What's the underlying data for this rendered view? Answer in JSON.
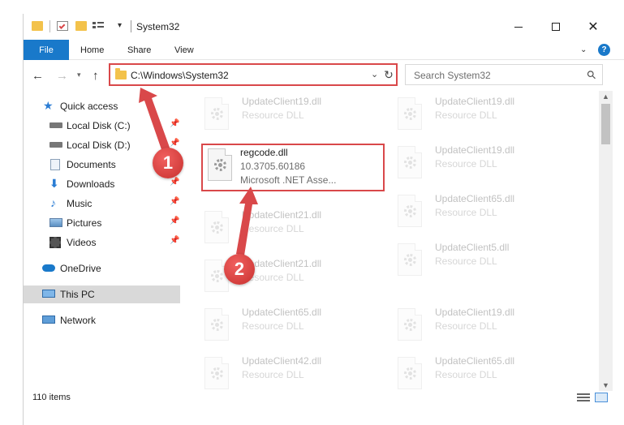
{
  "window": {
    "title": "System32"
  },
  "ribbon": {
    "file": "File",
    "home": "Home",
    "share": "Share",
    "view": "View"
  },
  "nav": {
    "address": "C:\\Windows\\System32",
    "search_placeholder": "Search System32"
  },
  "sidebar": {
    "items": [
      {
        "label": "Quick access",
        "icon": "star-icon"
      },
      {
        "label": "Local Disk (C:)",
        "icon": "drive-icon"
      },
      {
        "label": "Local Disk (D:)",
        "icon": "drive-icon"
      },
      {
        "label": "Documents",
        "icon": "documents-icon"
      },
      {
        "label": "Downloads",
        "icon": "download-icon"
      },
      {
        "label": "Music",
        "icon": "music-icon"
      },
      {
        "label": "Pictures",
        "icon": "pictures-icon"
      },
      {
        "label": "Videos",
        "icon": "videos-icon"
      },
      {
        "label": "OneDrive",
        "icon": "cloud-icon"
      },
      {
        "label": "This PC",
        "icon": "computer-icon"
      },
      {
        "label": "Network",
        "icon": "network-icon"
      }
    ]
  },
  "files": {
    "highlighted": {
      "name": "regcode.dll",
      "version": "10.3705.60186",
      "desc": "Microsoft .NET Asse..."
    },
    "left": [
      {
        "name": "UpdateClient19.dll",
        "desc": "Resource DLL"
      },
      {
        "name": "UpdateClient21.dll",
        "desc": "Resource DLL"
      },
      {
        "name": "UpdateClient21.dll",
        "desc": "Resource DLL"
      },
      {
        "name": "UpdateClient65.dll",
        "desc": "Resource DLL"
      },
      {
        "name": "UpdateClient42.dll",
        "desc": "Resource DLL"
      }
    ],
    "right": [
      {
        "name": "UpdateClient19.dll",
        "desc": "Resource DLL"
      },
      {
        "name": "UpdateClient19.dll",
        "desc": "Resource DLL"
      },
      {
        "name": "UpdateClient65.dll",
        "desc": "Resource DLL"
      },
      {
        "name": "UpdateClient5.dll",
        "desc": "Resource DLL"
      },
      {
        "name": "UpdateClient19.dll",
        "desc": "Resource DLL"
      },
      {
        "name": "UpdateClient65.dll",
        "desc": "Resource DLL"
      }
    ]
  },
  "status": {
    "count": "110 items"
  },
  "annotations": {
    "one": "1",
    "two": "2"
  },
  "colors": {
    "accent": "#1979ca",
    "highlight": "#d9484a"
  }
}
